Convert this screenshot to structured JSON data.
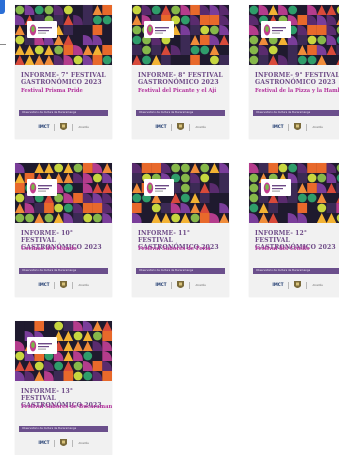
{
  "observatory_name": "Observatorio de Cultura de Bucaramanga",
  "footer": {
    "logo_main": "IMCT",
    "logo_sub": "",
    "partner_text": "Alcaldía"
  },
  "colors": {
    "title": "#6d4a86",
    "subtitle": "#b3329c",
    "band": "#6b4f8c"
  },
  "cards": [
    {
      "title": "INFORME- 7° FESTIVAL GASTRONÓMICO 2023",
      "festival": "Festival Prisma Pride"
    },
    {
      "title": "INFORME- 8° FESTIVAL GASTRONÓMICO 2023",
      "festival": "Festival del Picante y el Ají"
    },
    {
      "title": "INFORME- 9° FESTIVAL GASTRONÓMICO 2023",
      "festival": "Festival de la Pizza y la Hamburguesa"
    },
    {
      "title": "INFORME- 10° FESTIVAL GASTRONÓMICO 2023",
      "festival": "Cocinas del Mundo"
    },
    {
      "title": "INFORME- 11° FESTIVAL GASTRONÓMICO 2023",
      "festival": "Festival Sabores de Feria"
    },
    {
      "title": "INFORME- 12° FESTIVAL GASTRONÓMICO 2023",
      "festival": "Festival del Criollo"
    },
    {
      "title": "INFORME- 13° FESTIVAL GASTRONÓMICO 2023",
      "festival": "Festival Sabores de Bucaramanga"
    }
  ]
}
